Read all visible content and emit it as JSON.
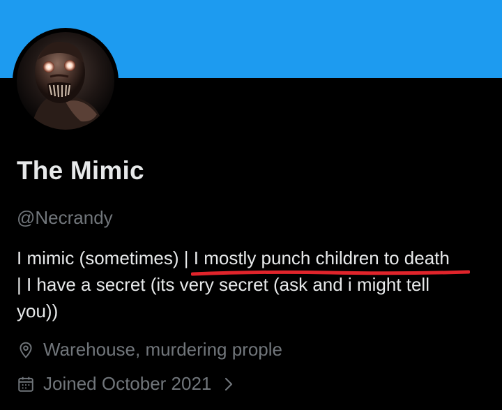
{
  "profile": {
    "display_name": "The Mimic",
    "handle": "@Necrandy",
    "bio": {
      "line1_before": "I mimic (sometimes) | ",
      "line1_highlight": "I mostly punch children to death",
      "line2": "| I have a secret (its very secret (ask and i might tell",
      "line3": "you))"
    },
    "location": "Warehouse, murdering prople",
    "joined": "Joined October 2021"
  },
  "icons": {
    "location": "location-pin-icon",
    "joined": "calendar-icon",
    "chevron": "chevron-right-icon"
  },
  "colors": {
    "banner": "#1d9bf0",
    "background": "#000000",
    "primary_text": "#e7e9ea",
    "secondary_text": "#71767b",
    "annotation_underline": "#e0242b"
  }
}
